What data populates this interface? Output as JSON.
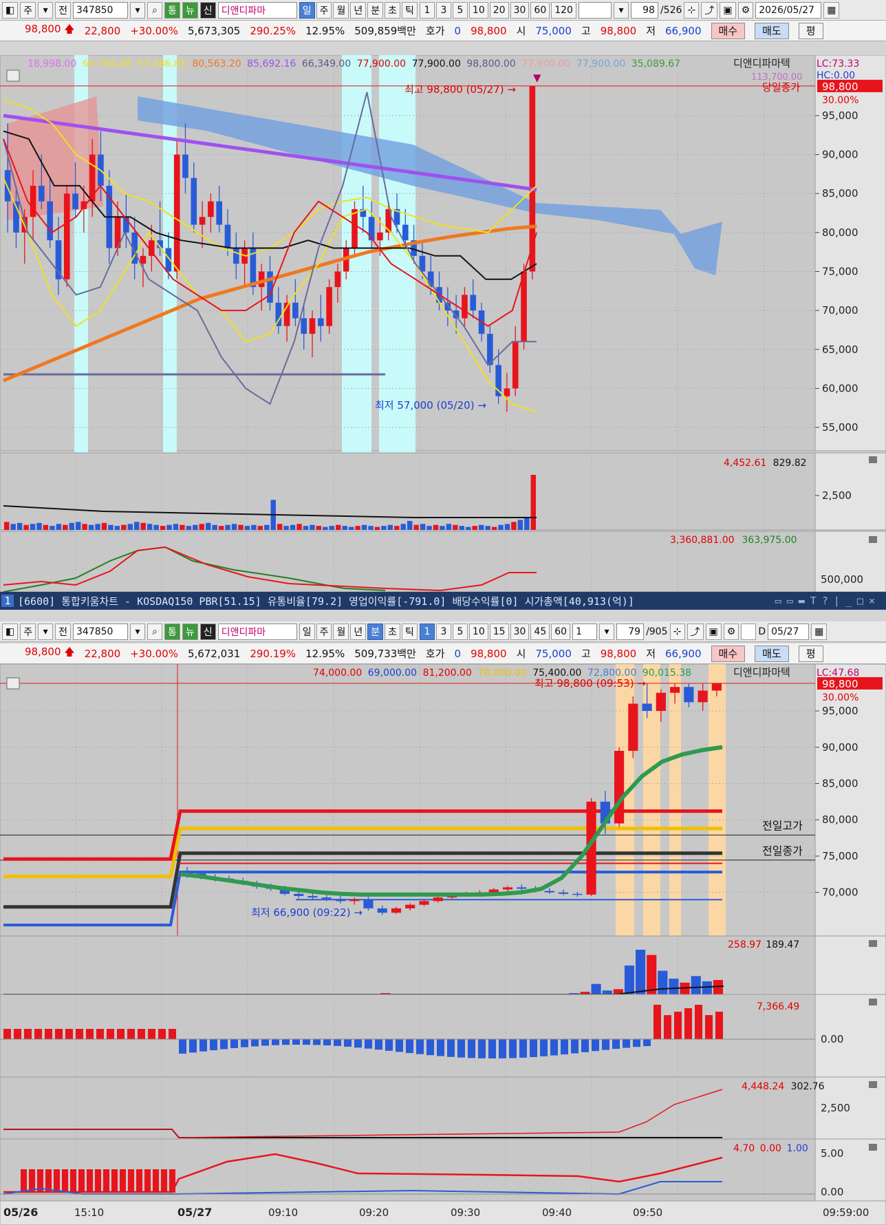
{
  "toolbar_top": {
    "period_label": "주",
    "kind_label": "전",
    "code": "347850",
    "tab_1": "통",
    "tab_2": "뉴",
    "tab_3": "신",
    "name": "디앤디파마",
    "periods": [
      "일",
      "주",
      "월",
      "년",
      "분",
      "초",
      "틱"
    ],
    "selected_period": "일",
    "intervals": [
      "1",
      "3",
      "5",
      "10",
      "20",
      "30",
      "60",
      "120"
    ],
    "count": "98",
    "total": "/526",
    "date": "2026/05/27"
  },
  "quote_top": {
    "price": "98,800",
    "change": "22,800",
    "change_pct": "+30.00%",
    "volume": "5,673,305",
    "vol_ratio": "290.25%",
    "turnover": "12.95%",
    "amount": "509,859백만",
    "hoga_label": "호가",
    "hoga_value": "0",
    "hoga_price": "98,800",
    "open_label": "시",
    "open": "75,000",
    "high_label": "고",
    "high": "98,800",
    "low_label": "저",
    "low": "66,900",
    "buy": "매수",
    "sell": "매도",
    "eval": "평"
  },
  "status_bar": {
    "number": "1",
    "text": "[6600] 통합키움차트 - KOSDAQ150 PBR[51.15] 유통비율[79.2] 영업이익률[-791.0] 배당수익률[0] 시가총액[40,913(억)]"
  },
  "toolbar_bottom": {
    "period_label": "주",
    "kind_label": "전",
    "code": "347850",
    "tab_1": "통",
    "tab_2": "뉴",
    "tab_3": "신",
    "name": "디앤디파마",
    "periods": [
      "일",
      "주",
      "월",
      "년",
      "분",
      "초",
      "틱"
    ],
    "selected_period": "분",
    "intervals": [
      "1",
      "3",
      "5",
      "10",
      "15",
      "30",
      "45",
      "60"
    ],
    "selected_interval": "1",
    "mult": "1",
    "count": "79",
    "total": "/905",
    "d_label": "D",
    "date": "05/27"
  },
  "quote_bottom": {
    "price": "98,800",
    "change": "22,800",
    "change_pct": "+30.00%",
    "volume": "5,672,031",
    "vol_ratio": "290.19%",
    "turnover": "12.95%",
    "amount": "509,733백만",
    "hoga_label": "호가",
    "hoga_value": "0",
    "hoga_price": "98,800",
    "open_label": "시",
    "open": "75,000",
    "high_label": "고",
    "high": "98,800",
    "low_label": "저",
    "low": "66,900",
    "buy": "매수",
    "sell": "매도",
    "eval": "평"
  },
  "colors": {
    "up": "#e8141c",
    "down": "#2a5bd7",
    "ma_yellow": "#f0e020",
    "ma_purple": "#a050f0",
    "ma_orange": "#f07820",
    "cloud_red": "#e89090",
    "cloud_blue": "#6f9fe0",
    "highlight_cyan": "#c8ffff",
    "highlight_orange": "#ffd8a0"
  },
  "chart_data": [
    {
      "type": "candlestick",
      "panel": "daily-price",
      "legend_values": [
        "18,998.00",
        "65,756.48",
        "57,386.85",
        "80,563.20",
        "85,692.16",
        "66,349.00",
        "77,900.00",
        "77,900.00",
        "98,800.00",
        "77,900.00",
        "77,900.00",
        "35,089.67"
      ],
      "legend_name": "디앤디파마텍",
      "lc": "LC:73.33",
      "hc": "HC:0.00",
      "hc_extra": "113,700.00",
      "today_close_label": "당일종가",
      "last_price": "98,800",
      "last_pct": "30.00%",
      "high_annotation": "최고 98,800 (05/27)",
      "low_annotation": "최저 57,000 (05/20)",
      "y_ticks": [
        "95,000",
        "90,000",
        "85,000",
        "80,000",
        "75,000",
        "70,000",
        "65,000",
        "60,000",
        "55,000"
      ],
      "ylim": [
        52000,
        101000
      ],
      "candles": [
        [
          88000,
          94000,
          80000,
          84000
        ],
        [
          84000,
          86000,
          78000,
          80000
        ],
        [
          80000,
          83000,
          76000,
          82000
        ],
        [
          82000,
          88000,
          79000,
          86000
        ],
        [
          86000,
          90000,
          83000,
          84000
        ],
        [
          84000,
          87000,
          78000,
          79000
        ],
        [
          79000,
          82000,
          72000,
          74000
        ],
        [
          74000,
          86000,
          73000,
          85000
        ],
        [
          85000,
          89000,
          82000,
          83000
        ],
        [
          83000,
          86000,
          80000,
          84000
        ],
        [
          84000,
          92000,
          82000,
          90000
        ],
        [
          90000,
          93000,
          84000,
          86000
        ],
        [
          86000,
          88000,
          76000,
          78000
        ],
        [
          78000,
          84000,
          77000,
          82000
        ],
        [
          82000,
          85000,
          78000,
          80000
        ],
        [
          80000,
          82000,
          74000,
          76000
        ],
        [
          76000,
          78000,
          73000,
          77000
        ],
        [
          77000,
          81000,
          75000,
          79000
        ],
        [
          79000,
          84000,
          77000,
          78000
        ],
        [
          78000,
          80000,
          74000,
          75000
        ],
        [
          75000,
          92000,
          74000,
          90000
        ],
        [
          90000,
          94000,
          85000,
          87000
        ],
        [
          87000,
          89000,
          80000,
          81000
        ],
        [
          81000,
          84000,
          78000,
          82000
        ],
        [
          82000,
          85000,
          80000,
          84000
        ],
        [
          84000,
          86000,
          80000,
          81000
        ],
        [
          81000,
          83000,
          77000,
          78000
        ],
        [
          78000,
          80000,
          74000,
          76000
        ],
        [
          76000,
          79000,
          73000,
          78000
        ],
        [
          78000,
          80000,
          72000,
          73000
        ],
        [
          73000,
          76000,
          70000,
          75000
        ],
        [
          75000,
          77000,
          70000,
          71000
        ],
        [
          71000,
          73000,
          67000,
          68000
        ],
        [
          68000,
          72000,
          66000,
          71000
        ],
        [
          71000,
          74000,
          68000,
          69000
        ],
        [
          69000,
          71000,
          65000,
          67000
        ],
        [
          67000,
          70000,
          64000,
          69000
        ],
        [
          69000,
          72000,
          66000,
          68000
        ],
        [
          68000,
          74000,
          67000,
          73000
        ],
        [
          73000,
          76000,
          71000,
          75000
        ],
        [
          75000,
          79000,
          74000,
          78000
        ],
        [
          78000,
          84000,
          77000,
          83000
        ],
        [
          83000,
          86000,
          80000,
          82000
        ],
        [
          82000,
          84000,
          78000,
          79000
        ],
        [
          79000,
          82000,
          77000,
          80000
        ],
        [
          80000,
          84000,
          79000,
          83000
        ],
        [
          83000,
          85000,
          80000,
          81000
        ],
        [
          81000,
          83000,
          78000,
          79000
        ],
        [
          79000,
          81000,
          76000,
          77000
        ],
        [
          77000,
          79000,
          74000,
          75000
        ],
        [
          75000,
          77000,
          72000,
          73000
        ],
        [
          73000,
          75000,
          70000,
          71000
        ],
        [
          71000,
          73000,
          68000,
          70000
        ],
        [
          70000,
          72000,
          67000,
          69000
        ],
        [
          69000,
          73000,
          68000,
          72000
        ],
        [
          72000,
          74000,
          69000,
          70000
        ],
        [
          70000,
          71000,
          66000,
          67000
        ],
        [
          67000,
          68000,
          62000,
          63000
        ],
        [
          63000,
          65000,
          58000,
          59000
        ],
        [
          59000,
          62000,
          57000,
          60000
        ],
        [
          60000,
          68000,
          59000,
          66000
        ],
        [
          66000,
          76000,
          65000,
          75000
        ],
        [
          75000,
          98800,
          74000,
          98800
        ]
      ],
      "series": [
        {
          "name": "ma_purple",
          "values": [
            95000,
            94500,
            94000,
            93500,
            93000,
            92500,
            92000,
            91500,
            91000,
            90500,
            90000,
            89500,
            89000,
            88500,
            88000,
            87500,
            87000,
            86500,
            86000,
            85500
          ]
        },
        {
          "name": "ma_orange",
          "values": [
            61000,
            62500,
            64000,
            65500,
            67000,
            68500,
            70000,
            71500,
            72500,
            73500,
            74500,
            75500,
            76500,
            77500,
            78200,
            78900,
            79500,
            80000,
            80500,
            80800
          ]
        }
      ]
    },
    {
      "type": "bar",
      "panel": "daily-volume",
      "legend_values": [
        "4,452.61",
        "829.82"
      ],
      "y_ticks": [
        "2,500"
      ],
      "values": [
        8,
        6,
        7,
        5,
        6,
        7,
        5,
        4,
        6,
        5,
        7,
        8,
        6,
        5,
        6,
        7,
        5,
        4,
        5,
        6,
        8,
        7,
        6,
        5,
        4,
        5,
        6,
        5,
        4,
        5,
        6,
        7,
        5,
        4,
        5,
        6,
        5,
        4,
        5,
        4,
        5,
        30,
        6,
        4,
        5,
        6,
        4,
        5,
        4,
        3,
        4,
        5,
        4,
        3,
        4,
        5,
        4,
        3,
        4,
        5,
        4,
        6,
        9,
        5,
        6,
        4,
        5,
        4,
        6,
        5,
        4,
        3,
        4,
        5,
        4,
        3,
        5,
        6,
        8,
        10,
        12,
        55
      ]
    },
    {
      "type": "line",
      "panel": "daily-indicator",
      "legend_values": [
        "3,360,881.00",
        "363,975.00"
      ],
      "y_ticks": [
        "500,000"
      ]
    },
    {
      "type": "candlestick",
      "panel": "minute-price",
      "legend_values": [
        "74,000.00",
        "69,000.00",
        "81,200.00",
        "78,800.00",
        "75,400.00",
        "72,800.00",
        "90,015.38"
      ],
      "legend_name": "디앤디파마텍",
      "lc": "LC:47.68",
      "last_price": "98,800",
      "last_pct": "30.00%",
      "high_annotation": "최고 98,800 (09:53)",
      "low_annotation": "최저 66,900 (09:22)",
      "prev_high_label": "전일고가",
      "prev_close_label": "전일종가",
      "y_ticks": [
        "95,000",
        "90,000",
        "85,000",
        "80,000",
        "75,000",
        "70,000"
      ],
      "ylim": [
        64000,
        100500
      ],
      "x_ticks": [
        "05/26",
        "15:10",
        "05/27",
        "09:10",
        "09:20",
        "09:30",
        "09:40",
        "09:50",
        "09:59:00"
      ],
      "levels": {
        "prev_high": 77900,
        "prev_close": 75400,
        "red": 81200,
        "yellow": 78800,
        "black": 75400,
        "blue": 72800,
        "blue_low": 69000
      },
      "candles": [
        [
          72800,
          73500,
          72000,
          72600
        ],
        [
          72600,
          73000,
          71800,
          72000
        ],
        [
          72000,
          72500,
          71500,
          71900
        ],
        [
          71900,
          72300,
          71400,
          71600
        ],
        [
          71600,
          72000,
          71000,
          71200
        ],
        [
          71200,
          71600,
          70500,
          70800
        ],
        [
          70800,
          71200,
          70200,
          70500
        ],
        [
          70500,
          70900,
          69600,
          69800
        ],
        [
          69800,
          70300,
          69200,
          69500
        ],
        [
          69500,
          69900,
          69000,
          69300
        ],
        [
          69300,
          69700,
          68800,
          69100
        ],
        [
          69100,
          69500,
          68500,
          68800
        ],
        [
          68800,
          69300,
          68300,
          69000
        ],
        [
          69000,
          69400,
          67500,
          67800
        ],
        [
          67800,
          68200,
          66900,
          67200
        ],
        [
          67200,
          68000,
          67000,
          67800
        ],
        [
          67800,
          68500,
          67500,
          68300
        ],
        [
          68300,
          69000,
          68100,
          68800
        ],
        [
          68800,
          69500,
          68600,
          69300
        ],
        [
          69300,
          69800,
          69100,
          69600
        ],
        [
          69600,
          70100,
          69400,
          69900
        ],
        [
          69900,
          70300,
          69600,
          70000
        ],
        [
          70000,
          70600,
          69800,
          70400
        ],
        [
          70400,
          70900,
          70100,
          70700
        ],
        [
          70700,
          71100,
          70300,
          70500
        ],
        [
          70500,
          70900,
          70000,
          70200
        ],
        [
          70200,
          70600,
          69800,
          70000
        ],
        [
          70000,
          70400,
          69600,
          69800
        ],
        [
          69800,
          70100,
          69400,
          69700
        ],
        [
          69700,
          83000,
          69500,
          82500
        ],
        [
          82500,
          84000,
          78000,
          79500
        ],
        [
          79500,
          90000,
          79000,
          89500
        ],
        [
          89500,
          97000,
          88500,
          96000
        ],
        [
          96000,
          98800,
          94000,
          95000
        ],
        [
          95000,
          98000,
          93500,
          97500
        ],
        [
          97500,
          98800,
          96000,
          98300
        ],
        [
          98300,
          98800,
          95500,
          96200
        ],
        [
          96200,
          98800,
          95000,
          97800
        ],
        [
          97800,
          98800,
          97000,
          98800
        ]
      ],
      "series": [
        {
          "name": "green_ma",
          "values": [
            72500,
            72200,
            71800,
            71400,
            71000,
            70600,
            70300,
            70000,
            69800,
            69700,
            69700,
            69700,
            69700,
            69700,
            69700,
            69700,
            69800,
            70000,
            70500,
            72000,
            75000,
            79000,
            83000,
            86000,
            88000,
            89000,
            89600,
            90015
          ]
        }
      ]
    },
    {
      "type": "bar",
      "panel": "minute-volume",
      "legend_values": [
        "258.97",
        "189.47"
      ],
      "values": [
        0,
        0,
        0,
        0,
        0,
        0,
        0,
        0,
        0,
        0,
        0,
        0,
        0,
        0,
        0,
        0,
        0,
        0,
        1,
        0,
        0,
        0,
        0,
        0,
        0,
        0,
        0,
        0,
        0,
        0,
        0,
        0,
        0,
        0,
        0,
        1,
        2,
        8,
        3,
        4,
        22,
        34,
        30,
        18,
        12,
        9,
        14,
        10,
        11
      ]
    },
    {
      "type": "bar",
      "panel": "minute-macd",
      "legend_values": [
        "7,366.49"
      ],
      "y_ticks": [
        "0.00"
      ]
    },
    {
      "type": "line",
      "panel": "minute-obv",
      "legend_values": [
        "4,448.24",
        "302.76"
      ],
      "y_ticks": [
        "2,500"
      ]
    },
    {
      "type": "line",
      "panel": "minute-rsi",
      "legend_values": [
        "4.70",
        "0.00",
        "1.00"
      ],
      "y_ticks": [
        "5.00",
        "0.00"
      ]
    }
  ]
}
